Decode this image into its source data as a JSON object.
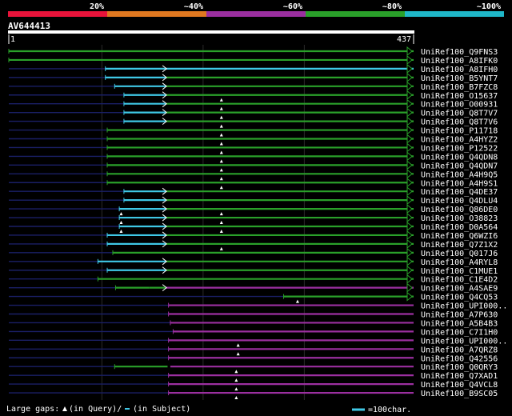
{
  "header": {
    "legend_bar": [
      {
        "label": "20%",
        "color": "#e8133a"
      },
      {
        "label": "~40%",
        "color": "#e07820"
      },
      {
        "label": "~60%",
        "color": "#9b2fa0"
      },
      {
        "label": "~80%",
        "color": "#2aa02a"
      },
      {
        "label": "~100%",
        "color": "#1fb7c8"
      }
    ],
    "query_id": "AV644413",
    "query_start": "1",
    "query_end": "437"
  },
  "colors": {
    "green": "#2aa02a",
    "cyan": "#3fc8e6",
    "purple": "#9b2fa0",
    "navy": "#1a1f66",
    "gap": "#ffffff",
    "query_bar": "#ffffff"
  },
  "hits": [
    {
      "id": "UniRef100_Q9FNS3",
      "segs": [
        {
          "s": 1,
          "e": 437,
          "c": "green"
        }
      ],
      "open_start": true,
      "arrow": true
    },
    {
      "id": "UniRef100_A8IFK0",
      "segs": [
        {
          "s": 1,
          "e": 437,
          "c": "green"
        }
      ],
      "open_start": true,
      "arrow": true
    },
    {
      "id": "UniRef100_A8IFH0",
      "segs": [
        {
          "s": 1,
          "e": 105,
          "c": "navy"
        },
        {
          "s": 105,
          "e": 170,
          "c": "cyan"
        },
        {
          "s": 170,
          "e": 437,
          "c": "cyan"
        }
      ],
      "arrow": true
    },
    {
      "id": "UniRef100_B5YNT7",
      "segs": [
        {
          "s": 1,
          "e": 105,
          "c": "navy"
        },
        {
          "s": 105,
          "e": 170,
          "c": "cyan"
        },
        {
          "s": 170,
          "e": 437,
          "c": "green"
        }
      ],
      "arrow": true
    },
    {
      "id": "UniRef100_B7FZC8",
      "segs": [
        {
          "s": 1,
          "e": 115,
          "c": "navy"
        },
        {
          "s": 115,
          "e": 170,
          "c": "cyan"
        },
        {
          "s": 170,
          "e": 437,
          "c": "green"
        }
      ],
      "arrow": true
    },
    {
      "id": "UniRef100_O15637",
      "segs": [
        {
          "s": 1,
          "e": 125,
          "c": "navy"
        },
        {
          "s": 125,
          "e": 170,
          "c": "cyan"
        },
        {
          "s": 170,
          "e": 437,
          "c": "green"
        }
      ],
      "arrow": true,
      "gap_at": 230
    },
    {
      "id": "UniRef100_O00931",
      "segs": [
        {
          "s": 1,
          "e": 125,
          "c": "navy"
        },
        {
          "s": 125,
          "e": 170,
          "c": "cyan"
        },
        {
          "s": 170,
          "e": 437,
          "c": "green"
        }
      ],
      "arrow": true,
      "gap_at": 230
    },
    {
      "id": "UniRef100_Q8T7V7",
      "segs": [
        {
          "s": 1,
          "e": 125,
          "c": "navy"
        },
        {
          "s": 125,
          "e": 170,
          "c": "cyan"
        },
        {
          "s": 170,
          "e": 437,
          "c": "green"
        }
      ],
      "arrow": true,
      "gap_at": 230
    },
    {
      "id": "UniRef100_Q8T7V6",
      "segs": [
        {
          "s": 1,
          "e": 125,
          "c": "navy"
        },
        {
          "s": 125,
          "e": 170,
          "c": "cyan"
        },
        {
          "s": 170,
          "e": 437,
          "c": "green"
        }
      ],
      "arrow": true,
      "gap_at": 230
    },
    {
      "id": "UniRef100_P11718",
      "segs": [
        {
          "s": 1,
          "e": 107,
          "c": "navy"
        },
        {
          "s": 107,
          "e": 437,
          "c": "green"
        }
      ],
      "arrow": true,
      "gap_at": 230
    },
    {
      "id": "UniRef100_A4HYZ2",
      "segs": [
        {
          "s": 1,
          "e": 107,
          "c": "navy"
        },
        {
          "s": 107,
          "e": 437,
          "c": "green"
        }
      ],
      "arrow": true,
      "gap_at": 230
    },
    {
      "id": "UniRef100_P12522",
      "segs": [
        {
          "s": 1,
          "e": 107,
          "c": "navy"
        },
        {
          "s": 107,
          "e": 437,
          "c": "green"
        }
      ],
      "arrow": true,
      "gap_at": 230
    },
    {
      "id": "UniRef100_Q4QDN8",
      "segs": [
        {
          "s": 1,
          "e": 107,
          "c": "navy"
        },
        {
          "s": 107,
          "e": 437,
          "c": "green"
        }
      ],
      "arrow": true,
      "gap_at": 230
    },
    {
      "id": "UniRef100_Q4QDN7",
      "segs": [
        {
          "s": 1,
          "e": 107,
          "c": "navy"
        },
        {
          "s": 107,
          "e": 437,
          "c": "green"
        }
      ],
      "arrow": true,
      "gap_at": 230
    },
    {
      "id": "UniRef100_A4H9Q5",
      "segs": [
        {
          "s": 1,
          "e": 107,
          "c": "navy"
        },
        {
          "s": 107,
          "e": 437,
          "c": "green"
        }
      ],
      "arrow": true,
      "gap_at": 230
    },
    {
      "id": "UniRef100_A4H9S1",
      "segs": [
        {
          "s": 1,
          "e": 107,
          "c": "navy"
        },
        {
          "s": 107,
          "e": 437,
          "c": "green"
        }
      ],
      "arrow": true,
      "gap_at": 230
    },
    {
      "id": "UniRef100_Q4DE37",
      "segs": [
        {
          "s": 1,
          "e": 125,
          "c": "navy"
        },
        {
          "s": 125,
          "e": 170,
          "c": "cyan"
        },
        {
          "s": 170,
          "e": 437,
          "c": "green"
        }
      ],
      "arrow": true
    },
    {
      "id": "UniRef100_Q4DLU4",
      "segs": [
        {
          "s": 1,
          "e": 125,
          "c": "navy"
        },
        {
          "s": 125,
          "e": 170,
          "c": "cyan"
        },
        {
          "s": 170,
          "e": 437,
          "c": "green"
        }
      ],
      "arrow": true
    },
    {
      "id": "UniRef100_Q86DE0",
      "segs": [
        {
          "s": 1,
          "e": 120,
          "c": "navy"
        },
        {
          "s": 120,
          "e": 170,
          "c": "cyan"
        },
        {
          "s": 170,
          "e": 437,
          "c": "green"
        }
      ],
      "arrow": true,
      "gap_at": 230,
      "gap_at2": 122
    },
    {
      "id": "UniRef100_O38823",
      "segs": [
        {
          "s": 1,
          "e": 120,
          "c": "navy"
        },
        {
          "s": 120,
          "e": 170,
          "c": "cyan"
        },
        {
          "s": 170,
          "e": 437,
          "c": "green"
        }
      ],
      "arrow": true,
      "gap_at": 230,
      "gap_at2": 122
    },
    {
      "id": "UniRef100_D0A564",
      "segs": [
        {
          "s": 1,
          "e": 120,
          "c": "navy"
        },
        {
          "s": 120,
          "e": 170,
          "c": "cyan"
        },
        {
          "s": 170,
          "e": 437,
          "c": "green"
        }
      ],
      "arrow": true,
      "gap_at": 230,
      "gap_at2": 122
    },
    {
      "id": "UniRef100_Q6WZI6",
      "segs": [
        {
          "s": 1,
          "e": 107,
          "c": "navy"
        },
        {
          "s": 107,
          "e": 170,
          "c": "cyan"
        },
        {
          "s": 170,
          "e": 437,
          "c": "green"
        }
      ],
      "arrow": true
    },
    {
      "id": "UniRef100_Q7Z1X2",
      "segs": [
        {
          "s": 1,
          "e": 107,
          "c": "navy"
        },
        {
          "s": 107,
          "e": 170,
          "c": "cyan"
        },
        {
          "s": 170,
          "e": 437,
          "c": "green"
        }
      ],
      "arrow": true,
      "gap_at": 230
    },
    {
      "id": "UniRef100_Q017J6",
      "segs": [
        {
          "s": 1,
          "e": 113,
          "c": "navy"
        },
        {
          "s": 113,
          "e": 437,
          "c": "green"
        }
      ],
      "arrow": true
    },
    {
      "id": "UniRef100_A4RYL8",
      "segs": [
        {
          "s": 1,
          "e": 97,
          "c": "navy"
        },
        {
          "s": 97,
          "e": 170,
          "c": "cyan"
        },
        {
          "s": 170,
          "e": 437,
          "c": "green"
        }
      ],
      "arrow": true
    },
    {
      "id": "UniRef100_C1MUE1",
      "segs": [
        {
          "s": 1,
          "e": 107,
          "c": "navy"
        },
        {
          "s": 107,
          "e": 170,
          "c": "cyan"
        },
        {
          "s": 170,
          "e": 437,
          "c": "green"
        }
      ],
      "arrow": true
    },
    {
      "id": "UniRef100_C1E4D2",
      "segs": [
        {
          "s": 1,
          "e": 97,
          "c": "navy"
        },
        {
          "s": 97,
          "e": 437,
          "c": "green"
        }
      ],
      "arrow": true
    },
    {
      "id": "UniRef100_A4SAE9",
      "segs": [
        {
          "s": 1,
          "e": 116,
          "c": "navy"
        },
        {
          "s": 116,
          "e": 152,
          "c": "green"
        },
        {
          "s": 152,
          "e": 170,
          "c": "green"
        },
        {
          "s": 170,
          "e": 437,
          "c": "purple"
        }
      ],
      "arrow": true
    },
    {
      "id": "UniRef100_Q4CQ53",
      "segs": [
        {
          "s": 1,
          "e": 297,
          "c": "navy"
        },
        {
          "s": 297,
          "e": 437,
          "c": "green"
        }
      ],
      "arrow": true,
      "gap_at": 312
    },
    {
      "id": "UniRef100_UPI000..",
      "segs": [
        {
          "s": 1,
          "e": 173,
          "c": "navy"
        },
        {
          "s": 173,
          "e": 437,
          "c": "purple"
        }
      ],
      "arrow": false
    },
    {
      "id": "UniRef100_A7P630",
      "segs": [
        {
          "s": 1,
          "e": 173,
          "c": "navy"
        },
        {
          "s": 173,
          "e": 437,
          "c": "purple"
        }
      ],
      "arrow": false
    },
    {
      "id": "UniRef100_A5B4B3",
      "segs": [
        {
          "s": 1,
          "e": 175,
          "c": "navy"
        },
        {
          "s": 175,
          "e": 437,
          "c": "purple"
        }
      ],
      "arrow": false
    },
    {
      "id": "UniRef100_C7I1H0",
      "segs": [
        {
          "s": 1,
          "e": 178,
          "c": "navy"
        },
        {
          "s": 178,
          "e": 437,
          "c": "purple"
        }
      ],
      "arrow": false
    },
    {
      "id": "UniRef100_UPI000..",
      "segs": [
        {
          "s": 1,
          "e": 173,
          "c": "navy"
        },
        {
          "s": 173,
          "e": 437,
          "c": "purple"
        }
      ],
      "arrow": false,
      "gap_at": 248
    },
    {
      "id": "UniRef100_A7QRZ8",
      "segs": [
        {
          "s": 1,
          "e": 173,
          "c": "navy"
        },
        {
          "s": 173,
          "e": 437,
          "c": "purple"
        }
      ],
      "arrow": false,
      "gap_at": 248
    },
    {
      "id": "UniRef100_Q42556",
      "segs": [
        {
          "s": 1,
          "e": 173,
          "c": "navy"
        },
        {
          "s": 173,
          "e": 437,
          "c": "purple"
        }
      ],
      "arrow": false
    },
    {
      "id": "UniRef100_Q0QRY3",
      "segs": [
        {
          "s": 1,
          "e": 115,
          "c": "navy"
        },
        {
          "s": 115,
          "e": 172,
          "c": "green"
        },
        {
          "s": 175,
          "e": 437,
          "c": "purple"
        }
      ],
      "arrow": false,
      "gap_at": 246
    },
    {
      "id": "UniRef100_Q7XAD1",
      "segs": [
        {
          "s": 1,
          "e": 173,
          "c": "navy"
        },
        {
          "s": 173,
          "e": 437,
          "c": "purple"
        }
      ],
      "arrow": false,
      "gap_at": 246
    },
    {
      "id": "UniRef100_Q4VCL8",
      "segs": [
        {
          "s": 1,
          "e": 173,
          "c": "navy"
        },
        {
          "s": 173,
          "e": 437,
          "c": "purple"
        }
      ],
      "arrow": false,
      "gap_at": 246
    },
    {
      "id": "UniRef100_B9SC05",
      "segs": [
        {
          "s": 1,
          "e": 173,
          "c": "navy"
        },
        {
          "s": 173,
          "e": 437,
          "c": "purple"
        }
      ],
      "arrow": false,
      "gap_at": 246
    }
  ],
  "footer": {
    "gaps_label_prefix": "Large gaps:",
    "gaps_label_query": "(in Query)/",
    "gaps_label_subject": "(in Subject)",
    "scale_label": "=100char."
  }
}
